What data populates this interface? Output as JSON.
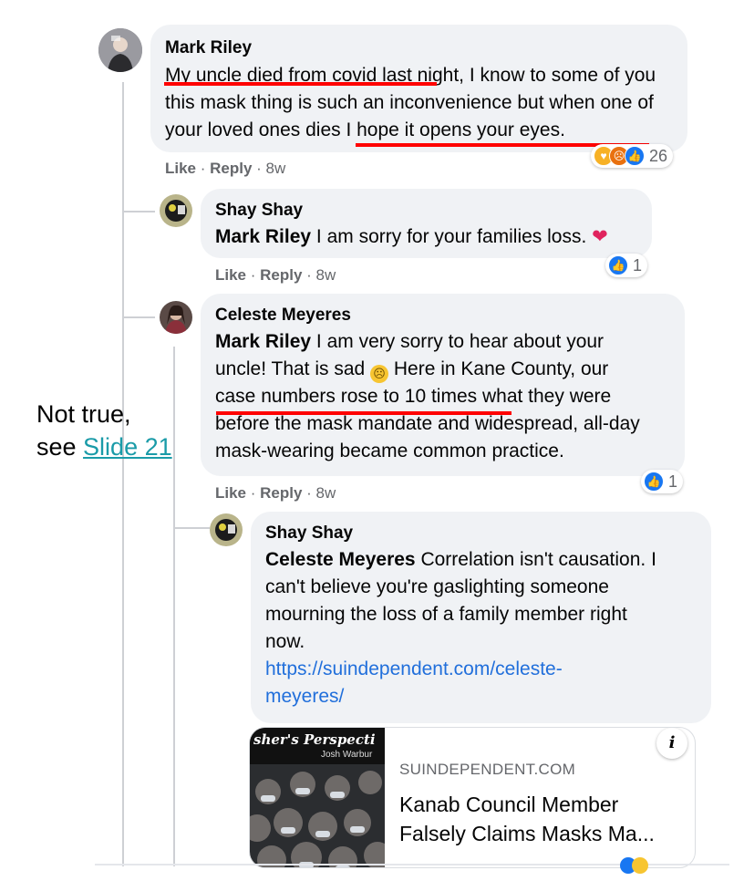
{
  "annotation": {
    "line1": "Not true,",
    "line2_prefix": "see ",
    "line2_link": "Slide 21"
  },
  "comments": [
    {
      "author": "Mark Riley",
      "text_underlined": "My uncle died from covid last night",
      "text_rest": ", I know to some of you this mask thing is such an inconvenience but when one of your loved ones dies I hope it opens your eyes.",
      "like": "Like",
      "reply": "Reply",
      "time": "8w",
      "reaction_count": "26"
    },
    {
      "author": "Shay Shay",
      "mention": "Mark Riley",
      "text": "I am sorry for your families loss.",
      "like": "Like",
      "reply": "Reply",
      "time": "8w",
      "reaction_count": "1"
    },
    {
      "author": "Celeste Meyeres",
      "mention": "Mark Riley",
      "text_a": "I am very sorry to hear about your uncle! That is sad ",
      "text_b": " Here in Kane County, our ",
      "text_underlined": "case numbers rose to 10 times",
      "text_c": " what they were before the mask mandate and widespread, all-day mask-wearing became common practice.",
      "like": "Like",
      "reply": "Reply",
      "time": "8w",
      "reaction_count": "1"
    },
    {
      "author": "Shay Shay",
      "mention": "Celeste Meyeres",
      "text": "Correlation isn't causation. I can't believe you're gaslighting someone mourning the loss of a family member right now.",
      "url_line1": "https://suindependent.com/celeste-",
      "url_line2": "meyeres/"
    }
  ],
  "link_card": {
    "domain": "SUINDEPENDENT.COM",
    "title_line1": "Kanab Council Member",
    "title_line2": "Falsely Claims Masks Ma...",
    "thumb_heading": "sher's Perspecti",
    "thumb_byline": "Josh Warbur",
    "info_glyph": "i"
  },
  "icons": {
    "reactions_main": [
      "care-icon",
      "angry-icon",
      "like-icon"
    ],
    "reaction_like": "like-icon",
    "emoji_heart": "heart-icon",
    "emoji_sad": "sad-face-icon"
  },
  "colors": {
    "underline": "#ff0000",
    "like_blue": "#1877f2",
    "link": "#216fdb",
    "annotation_link": "#1a9ba8"
  }
}
